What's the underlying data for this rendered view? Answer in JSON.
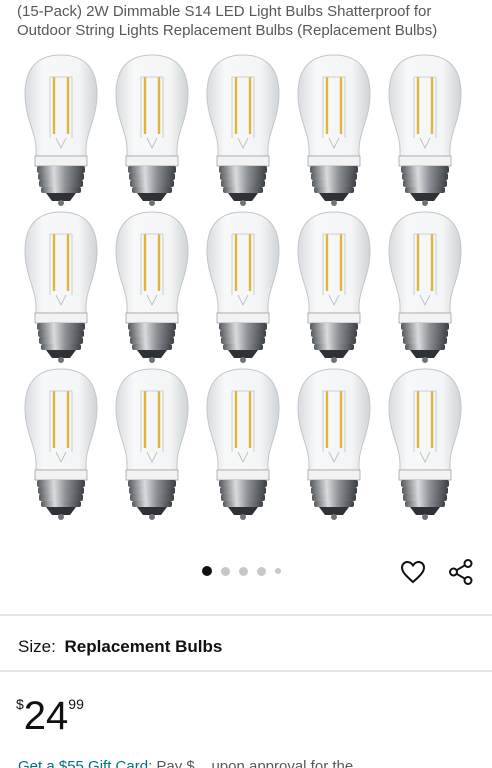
{
  "product": {
    "title": "(15-Pack) 2W Dimmable S14 LED Light Bulbs Shatterproof for Outdoor String Lights Replacement Bulbs (Replacement Bulbs)"
  },
  "gallery": {
    "image_count": 5,
    "active_index": 0
  },
  "actions": {
    "wishlist_icon": "heart-icon",
    "share_icon": "share-icon"
  },
  "size": {
    "label": "Size:",
    "value": "Replacement Bulbs"
  },
  "price": {
    "symbol": "$",
    "whole": "24",
    "fraction": "99"
  },
  "promo": {
    "link_text": "Get a $55 Gift Card",
    "rest_text": ": Pay $... upon approval for the"
  },
  "colors": {
    "link": "#007185",
    "text": "#0f1111",
    "muted": "#565959"
  }
}
